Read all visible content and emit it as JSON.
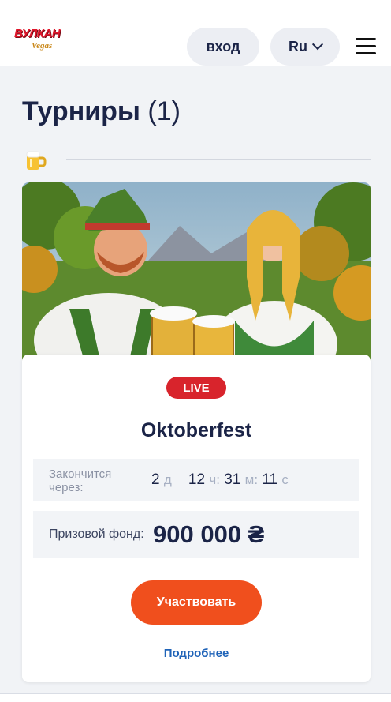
{
  "header": {
    "logo_text": "ВУЛКАН",
    "logo_sub": "Vegas",
    "login_label": "вход",
    "lang_label": "Ru"
  },
  "page": {
    "title": "Турниры",
    "count": "(1)"
  },
  "tournament": {
    "badge": "LIVE",
    "name": "Oktoberfest",
    "timer_label": "Закончится через:",
    "days": "2",
    "days_unit": "д",
    "hours": "12",
    "hours_unit": "ч",
    "minutes": "31",
    "minutes_unit": "м",
    "seconds": "11",
    "seconds_unit": "с",
    "prize_label": "Призовой фонд:",
    "prize_value": "900 000 ₴",
    "join_label": "Участвовать",
    "more_label": "Подробнее"
  },
  "icons": {
    "section_icon": "beer-mug-icon",
    "menu_icon": "hamburger-menu-icon",
    "lang_icon": "chevron-down-icon"
  },
  "colors": {
    "accent": "#f04f1d",
    "live": "#d8242c",
    "link": "#1f63b8",
    "text": "#1b2447"
  }
}
